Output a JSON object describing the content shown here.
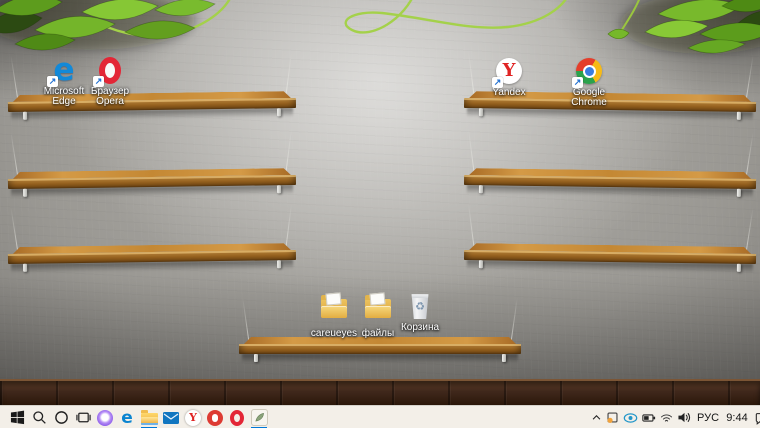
{
  "glyphs": {
    "edge_letter": "e",
    "yandex_letter": "Y",
    "recycle_symbol": "♻",
    "shortcut_arrow": "↗"
  },
  "desktop": {
    "icons": [
      {
        "name": "microsoft-edge-shortcut",
        "label": "Microsoft Edge"
      },
      {
        "name": "opera-shortcut",
        "label": "Браузер Opera"
      },
      {
        "name": "yandex-shortcut",
        "label": "Yandex"
      },
      {
        "name": "google-chrome-shortcut",
        "label": "Google Chrome"
      },
      {
        "name": "careueyes-folder",
        "label": "careueyes"
      },
      {
        "name": "files-folder",
        "label": "файлы"
      },
      {
        "name": "recycle-bin",
        "label": "Корзина"
      }
    ]
  },
  "taskbar": {
    "buttons": [
      "start",
      "search",
      "cortana",
      "task-view",
      "alice-assistant",
      "edge",
      "file-explorer",
      "mail",
      "yandex-browser",
      "red-app",
      "opera",
      "careueyes"
    ],
    "running_apps": [
      "file-explorer",
      "careueyes"
    ],
    "tray": {
      "language": "РУС",
      "time": "9:44"
    },
    "colors": {
      "taskbar_bg": "#f3efe8",
      "running_underline": "#0078d7"
    }
  },
  "wallpaper": {
    "colors": {
      "wall_light": "#c9c8c4",
      "wall_dark": "#4f4e4c",
      "shelf_wood": "#b97a2e",
      "leaf_green": "#7cbf2f",
      "floor_brown": "#40281c"
    }
  }
}
